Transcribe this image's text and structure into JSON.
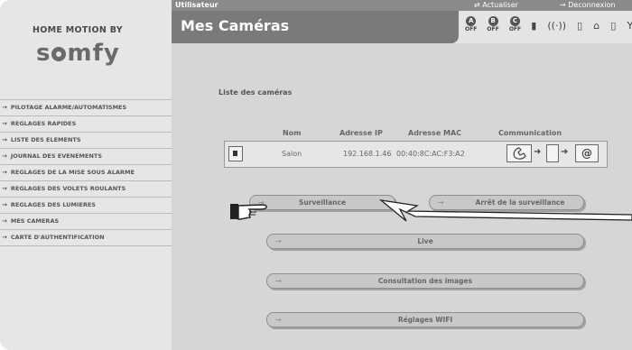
{
  "brand": {
    "top_text": "HOME MOTION BY",
    "logo": "somfy"
  },
  "topbar": {
    "user_label": "Utilisateur",
    "refresh_label": "Actualiser",
    "logout_label": "Deconnexion"
  },
  "header": {
    "title": "Mes Caméras",
    "status": [
      {
        "glyph": "A",
        "label": "OFF"
      },
      {
        "glyph": "B",
        "label": "OFF"
      },
      {
        "glyph": "C",
        "label": "OFF"
      }
    ],
    "status_extra_glyphs": [
      "▮",
      "((·))",
      "▯",
      "⌂",
      "▯",
      "Y"
    ]
  },
  "sidebar": {
    "items": [
      {
        "label": "PILOTAGE ALARME/AUTOMATISMES"
      },
      {
        "label": "REGLAGES RAPIDES"
      },
      {
        "label": "LISTE DES ELEMENTS"
      },
      {
        "label": "JOURNAL DES EVENEMENTS"
      },
      {
        "label": "REGLAGES DE LA MISE SOUS ALARME"
      },
      {
        "label": "REGLAGES DES VOLETS ROULANTS"
      },
      {
        "label": "REGLAGES DES LUMIERES"
      },
      {
        "label": "MES CAMERAS"
      },
      {
        "label": "CARTE D'AUTHENTIFICATION"
      }
    ]
  },
  "cameras": {
    "section_title": "Liste des caméras",
    "columns": [
      "Nom",
      "Adresse IP",
      "Adresse MAC",
      "Communication"
    ],
    "rows": [
      {
        "name": "Salon",
        "ip": "192.168.1.46",
        "mac": "00:40:8C:AC:F3:A2"
      }
    ],
    "comm_end_symbol": "@"
  },
  "buttons": {
    "surveillance": "Surveillance",
    "stop_surveillance": "Arrêt de la surveillance",
    "live": "Live",
    "images": "Consultation des images",
    "wifi": "Réglages WIFI"
  },
  "colors": {
    "accent": "#7a7a7a",
    "background": "#d6d6d6",
    "sidebar": "#e6e6e6"
  }
}
